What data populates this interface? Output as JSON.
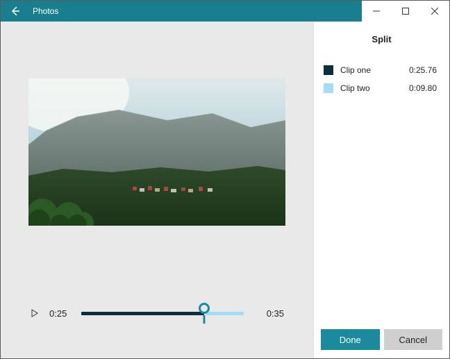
{
  "app_title": "Photos",
  "panel": {
    "title": "Split",
    "clips": [
      {
        "swatch": "c1",
        "name": "Clip one",
        "duration": "0:25.76"
      },
      {
        "swatch": "c2",
        "name": "Clip two",
        "duration": "0:09.80"
      }
    ],
    "done_label": "Done",
    "cancel_label": "Cancel"
  },
  "timeline": {
    "current": "0:25",
    "total": "0:35",
    "split_fraction": 0.72
  },
  "icons": {
    "back": "back-icon",
    "minimize": "minimize-icon",
    "maximize": "maximize-icon",
    "close": "close-icon",
    "play": "play-icon"
  }
}
